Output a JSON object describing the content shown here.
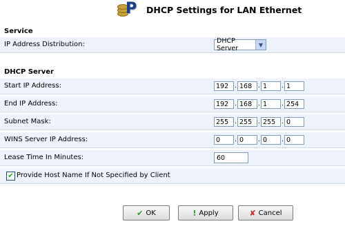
{
  "header": {
    "title": "DHCP Settings for LAN Ethernet",
    "logo_icon": "database-p-icon"
  },
  "service": {
    "section_title": "Service",
    "ip_distribution_label": "IP Address Distribution:",
    "ip_distribution_value": "DHCP Server"
  },
  "dhcp": {
    "section_title": "DHCP Server",
    "start_ip": {
      "label": "Start IP Address:",
      "octets": [
        "192",
        "168",
        "1",
        "1"
      ]
    },
    "end_ip": {
      "label": "End IP Address:",
      "octets": [
        "192",
        "168",
        "1",
        "254"
      ]
    },
    "subnet": {
      "label": "Subnet Mask:",
      "octets": [
        "255",
        "255",
        "255",
        "0"
      ]
    },
    "wins": {
      "label": "WINS Server IP Address:",
      "octets": [
        "0",
        "0",
        "0",
        "0"
      ]
    },
    "lease": {
      "label": "Lease Time In Minutes:",
      "value": "60"
    },
    "provide_host": {
      "label": "Provide Host Name If Not Specified by Client",
      "checked": true
    }
  },
  "buttons": {
    "ok": "OK",
    "apply": "Apply",
    "cancel": "Cancel"
  },
  "colors": {
    "row_bg": "#eef3fb",
    "title_blue": "#1c3e87"
  }
}
